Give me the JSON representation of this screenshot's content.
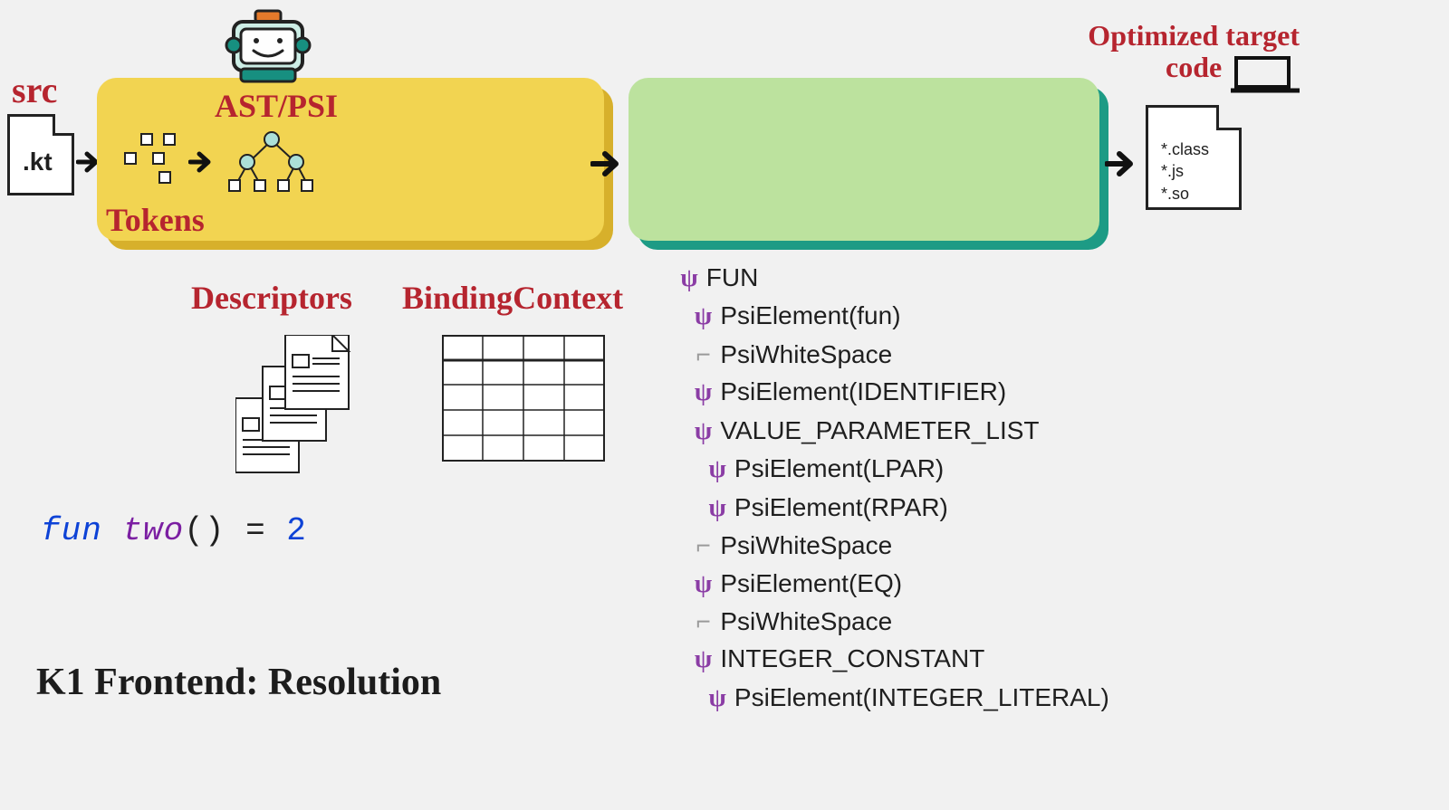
{
  "labels": {
    "src": "src",
    "tokens": "Tokens",
    "astpsi": "AST/PSI",
    "optimized": "Optimized target code",
    "descriptors": "Descriptors",
    "binding": "BindingContext",
    "title": "K1 Frontend: Resolution"
  },
  "src_file": {
    "ext": ".kt"
  },
  "out_file": {
    "exts": [
      "*.class",
      "*.js",
      "*.so"
    ]
  },
  "code": {
    "kw": "fun",
    "id": "two",
    "paren": "()",
    "eq": "=",
    "num": "2"
  },
  "psi_tree": [
    {
      "indent": 0,
      "glyph": "psi",
      "text": "FUN"
    },
    {
      "indent": 1,
      "glyph": "psi",
      "text": "PsiElement(fun)"
    },
    {
      "indent": 1,
      "glyph": "ws",
      "text": "PsiWhiteSpace"
    },
    {
      "indent": 1,
      "glyph": "psi",
      "text": "PsiElement(IDENTIFIER)"
    },
    {
      "indent": 1,
      "glyph": "psi",
      "text": "VALUE_PARAMETER_LIST"
    },
    {
      "indent": 2,
      "glyph": "psi",
      "text": "PsiElement(LPAR)"
    },
    {
      "indent": 2,
      "glyph": "psi",
      "text": "PsiElement(RPAR)"
    },
    {
      "indent": 1,
      "glyph": "ws",
      "text": "PsiWhiteSpace"
    },
    {
      "indent": 1,
      "glyph": "psi",
      "text": "PsiElement(EQ)"
    },
    {
      "indent": 1,
      "glyph": "ws",
      "text": "PsiWhiteSpace"
    },
    {
      "indent": 1,
      "glyph": "psi",
      "text": "INTEGER_CONSTANT"
    },
    {
      "indent": 2,
      "glyph": "psi",
      "text": "PsiElement(INTEGER_LITERAL)"
    }
  ]
}
